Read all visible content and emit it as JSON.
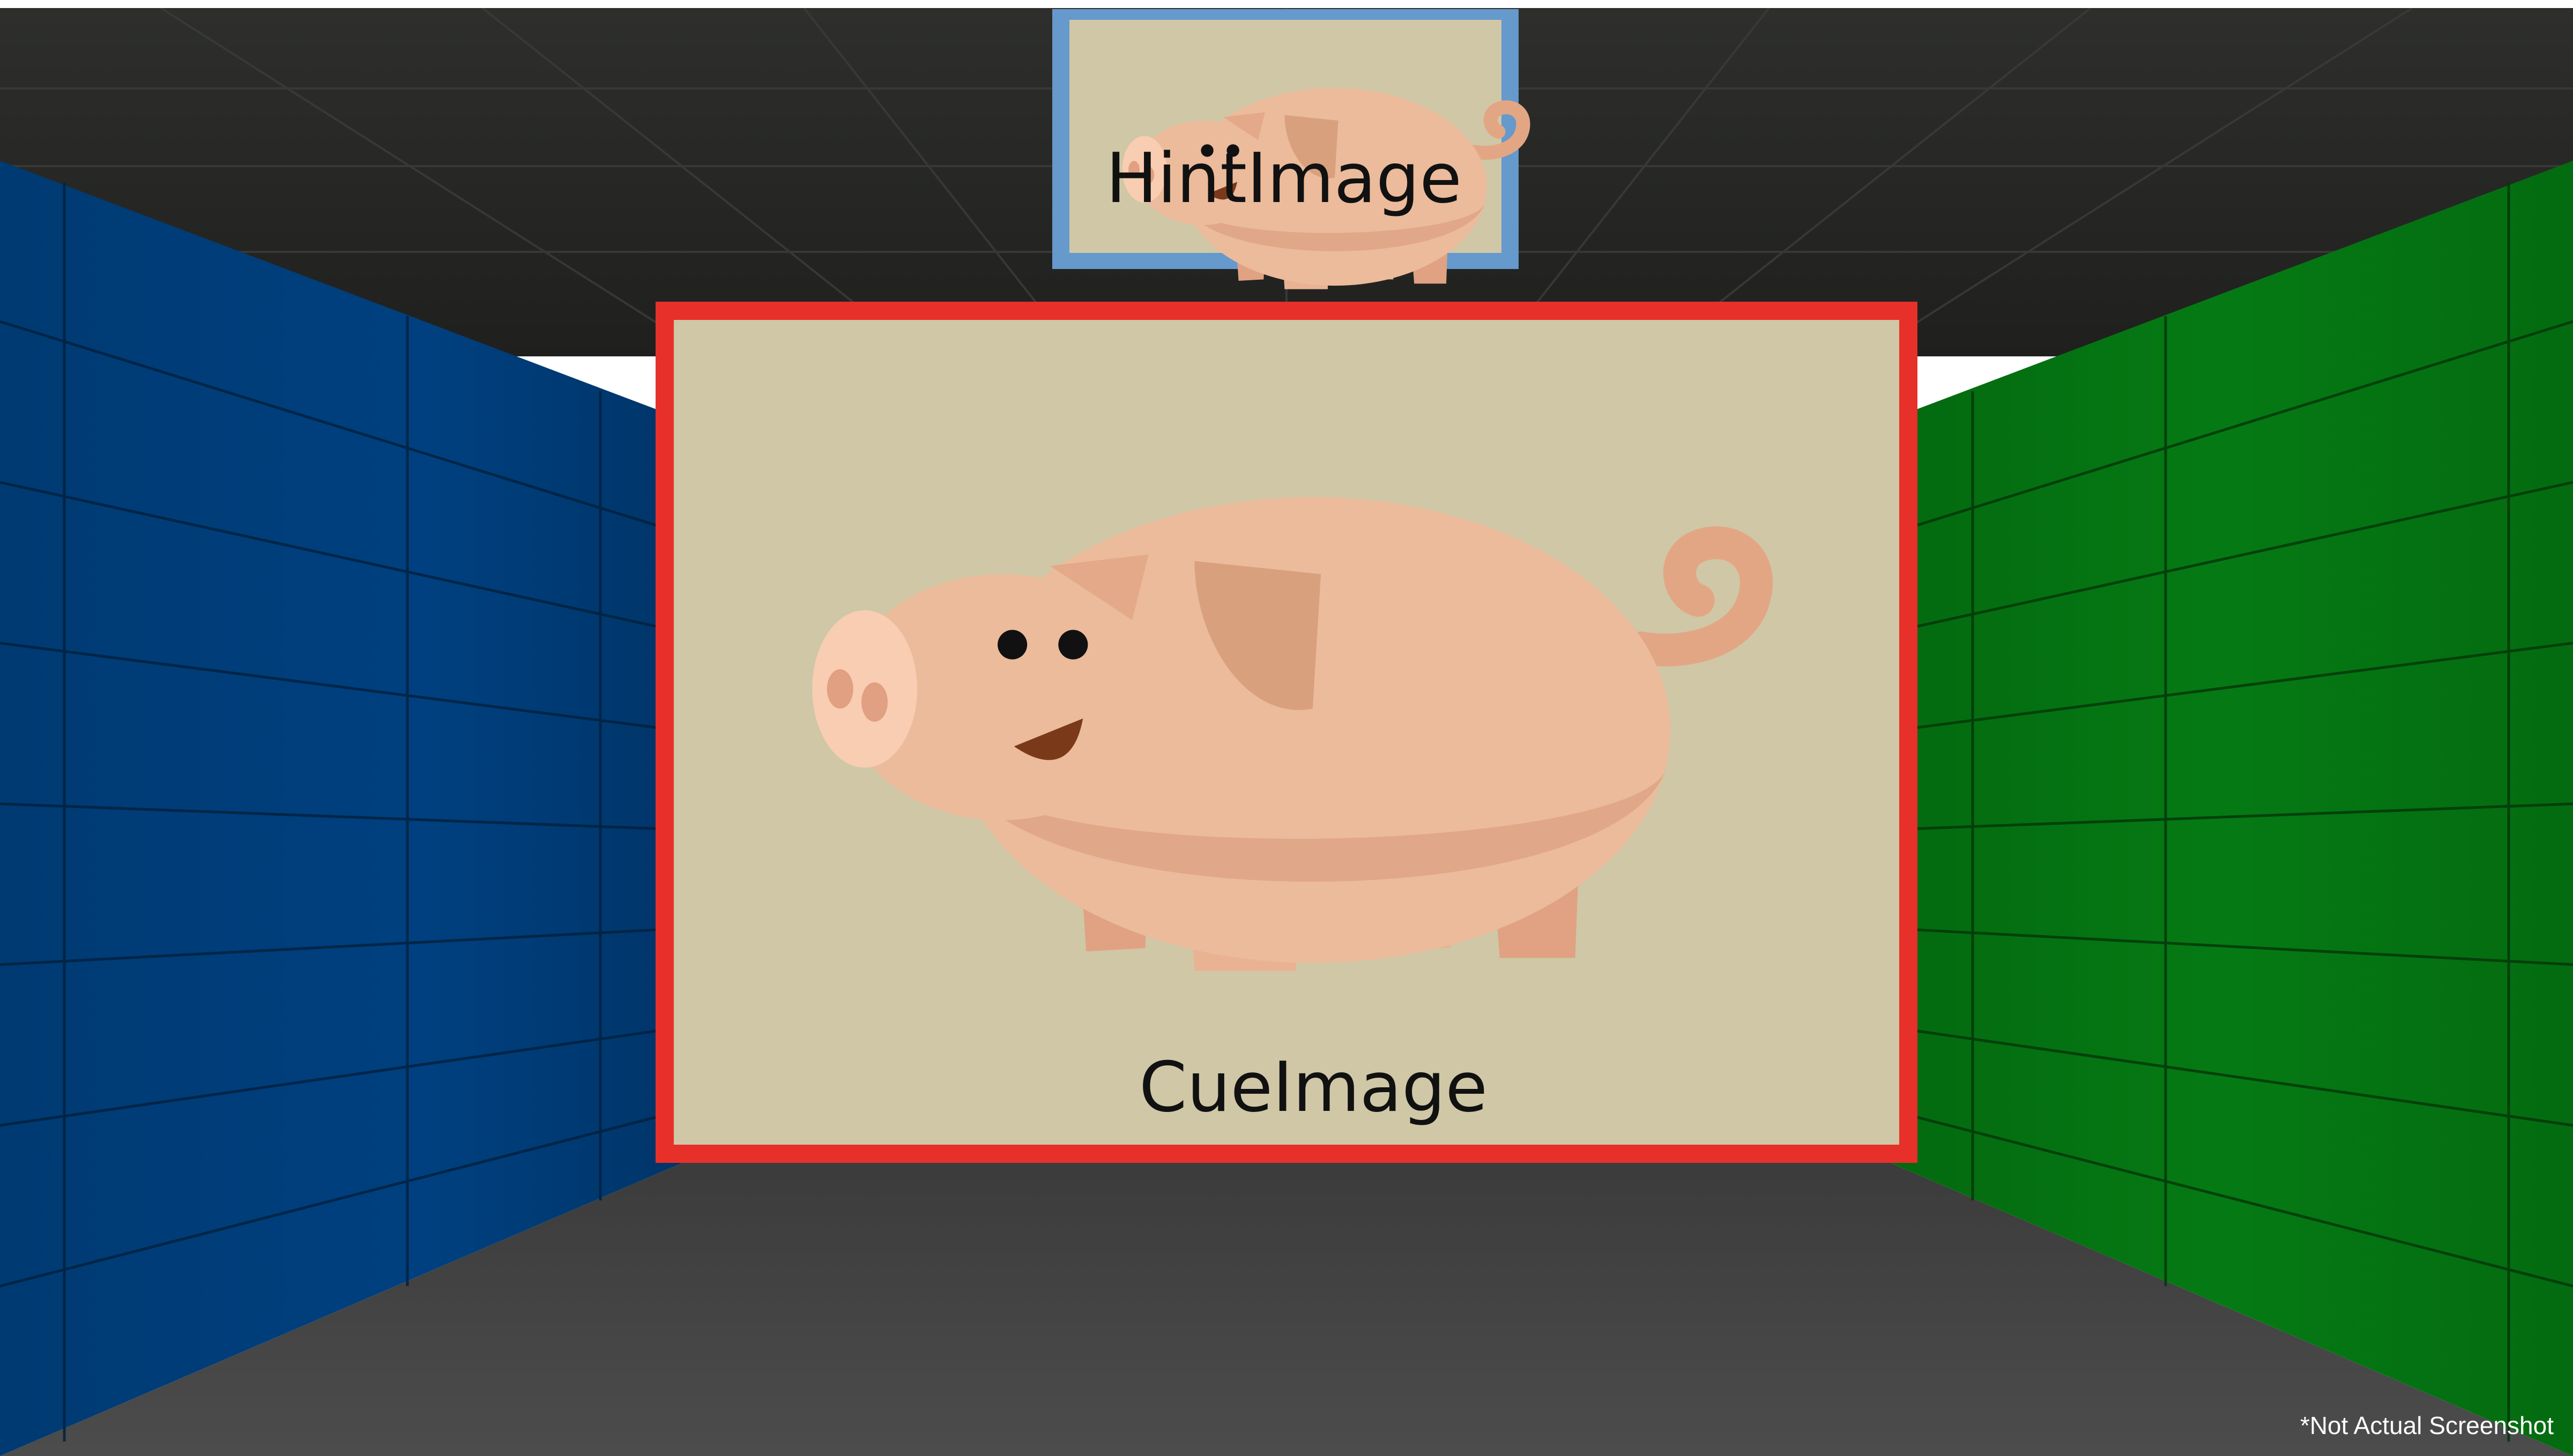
{
  "hint": {
    "label": "HintImage",
    "frame_color": "#6699cc",
    "background_color": "#cfc7a6",
    "icon": "pig-icon"
  },
  "cue": {
    "label": "CueImage",
    "frame_color": "#e8302a",
    "background_color": "#cfc7a6",
    "icon": "pig-icon"
  },
  "walls": {
    "left_color": "#003f7a",
    "right_color": "#047a12",
    "ceiling_color": "#2a2b29",
    "floor_color": "#454545"
  },
  "disclaimer": "*Not Actual Screenshot"
}
